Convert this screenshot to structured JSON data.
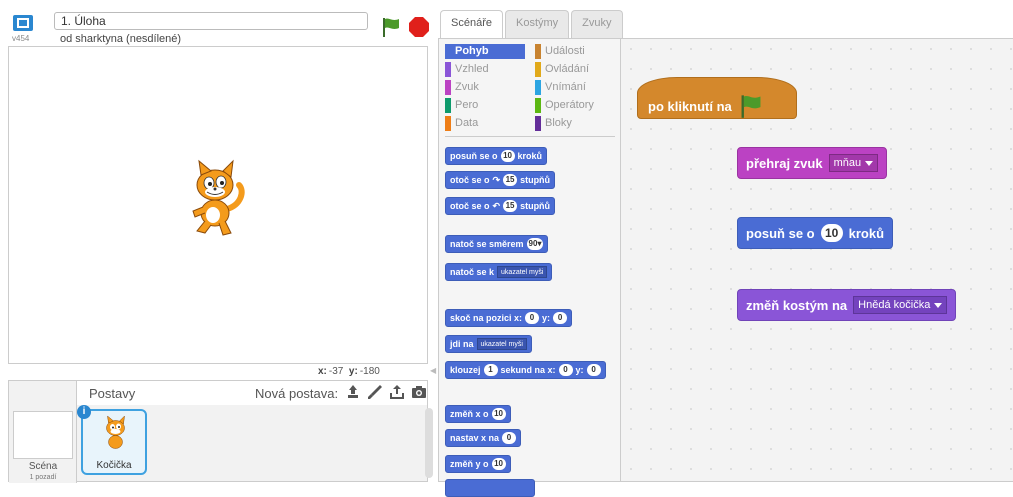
{
  "header": {
    "version": "v454",
    "title": "1. Úloha",
    "author": "od sharktyna (nesdílené)"
  },
  "stage": {
    "coord_x_label": "x:",
    "coord_x_value": "-37",
    "coord_y_label": "y:",
    "coord_y_value": "-180"
  },
  "sprites": {
    "header_label": "Postavy",
    "new_sprite_label": "Nová postava:",
    "new_sprite_icons": [
      "paint-stamp-icon",
      "brush-icon",
      "upload-icon",
      "camera-icon"
    ],
    "scene_label": "Scéna",
    "scene_sub": "1 pozadí",
    "items": [
      {
        "name": "Kočička"
      }
    ]
  },
  "tabs": [
    {
      "label": "Scénáře",
      "active": true
    },
    {
      "label": "Kostýmy",
      "active": false
    },
    {
      "label": "Zvuky",
      "active": false
    }
  ],
  "categories": [
    {
      "label": "Pohyb",
      "color": "#4a6cd4",
      "selected": true
    },
    {
      "label": "Vzhled",
      "color": "#8a55d7"
    },
    {
      "label": "Zvuk",
      "color": "#bb42c3"
    },
    {
      "label": "Pero",
      "color": "#0e9a6c"
    },
    {
      "label": "Data",
      "color": "#ee7d16"
    },
    {
      "label": "Události",
      "color": "#c88330"
    },
    {
      "label": "Ovládání",
      "color": "#e1a91a"
    },
    {
      "label": "Vnímání",
      "color": "#2ca5e2"
    },
    {
      "label": "Operátory",
      "color": "#5cb712"
    },
    {
      "label": "Bloky",
      "color": "#632d99"
    }
  ],
  "palette_blocks": {
    "move_pre": "posuň se o",
    "move_num": "10",
    "move_post": "kroků",
    "turn_right_pre": "otoč se o",
    "turn_right_num": "15",
    "turn_right_post": "stupňů",
    "turn_left_pre": "otoč se o",
    "turn_left_num": "15",
    "turn_left_post": "stupňů",
    "point_dir_pre": "natoč se směrem",
    "point_dir_val": "90▾",
    "point_to_pre": "natoč se k",
    "point_to_val": "ukazatel myši",
    "goto_xy_pre": "skoč na pozici x:",
    "goto_xy_x": "0",
    "goto_xy_mid": "y:",
    "goto_xy_y": "0",
    "goto_pre": "jdi na",
    "goto_val": "ukazatel myši",
    "glide_pre": "klouzej",
    "glide_num": "1",
    "glide_mid": "sekund na x:",
    "glide_x": "0",
    "glide_mid2": "y:",
    "glide_y": "0",
    "change_x_pre": "změň x o",
    "change_x_num": "10",
    "set_x_pre": "nastav x na",
    "set_x_num": "0",
    "change_y_pre": "změň y o",
    "change_y_num": "10"
  },
  "script": {
    "hat_label": "po kliknutí na",
    "sound_label": "přehraj zvuk",
    "sound_value": "mňau",
    "move_pre": "posuň se o",
    "move_num": "10",
    "move_post": "kroků",
    "costume_label": "změň kostým na",
    "costume_value": "Hnědá kočička"
  }
}
